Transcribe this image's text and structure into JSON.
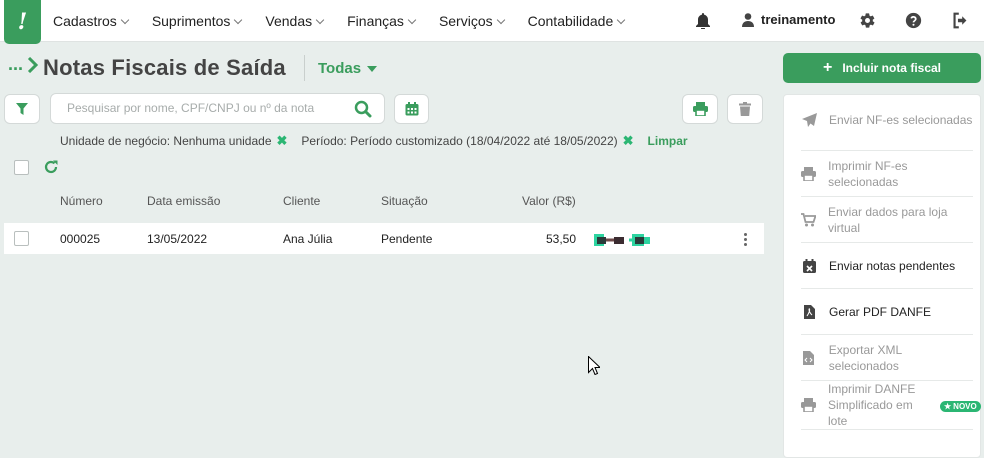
{
  "nav": {
    "logo_text": "!",
    "items": [
      {
        "label": "Cadastros"
      },
      {
        "label": "Suprimentos"
      },
      {
        "label": "Vendas"
      },
      {
        "label": "Finanças"
      },
      {
        "label": "Serviços"
      },
      {
        "label": "Contabilidade"
      }
    ],
    "user_name": "treinamento"
  },
  "header": {
    "breadcrumb": "...",
    "title": "Notas Fiscais de Saída",
    "filter_label": "Todas"
  },
  "search": {
    "placeholder": "Pesquisar por nome, CPF/CNPJ ou nº da nota",
    "value": ""
  },
  "chips": {
    "unidade": "Unidade de negócio: Nenhuma unidade",
    "periodo": "Período: Período customizado (18/04/2022 até 18/05/2022)",
    "remove_glyph": "✖",
    "clear": "Limpar"
  },
  "table": {
    "headers": {
      "numero": "Número",
      "data": "Data emissão",
      "cliente": "Cliente",
      "situacao": "Situação",
      "valor": "Valor (R$)"
    },
    "rows": [
      {
        "numero": "000025",
        "data": "13/05/2022",
        "cliente": "Ana Júlia",
        "situacao": "Pendente",
        "valor": "53,50"
      }
    ]
  },
  "panel": {
    "include_label": "Incluir nota fiscal",
    "actions": [
      {
        "label": "Enviar NF-es selecionadas",
        "icon": "send-icon"
      },
      {
        "label": "Imprimir NF-es selecionadas",
        "icon": "printer-icon"
      },
      {
        "label": "Enviar dados para loja virtual",
        "icon": "cart-icon"
      },
      {
        "label": "Enviar notas pendentes",
        "icon": "calendar-x-icon"
      },
      {
        "label": "Gerar PDF DANFE",
        "icon": "pdf-file-icon"
      },
      {
        "label": "Exportar XML selecionados",
        "icon": "code-file-icon"
      },
      {
        "label": "Imprimir DANFE Simplificado em lote",
        "icon": "printer-icon"
      }
    ],
    "new_badge": "NOVO"
  },
  "colors": {
    "primary": "#3a9d5d",
    "accent": "#2bb673",
    "background": "#e8eeec"
  }
}
